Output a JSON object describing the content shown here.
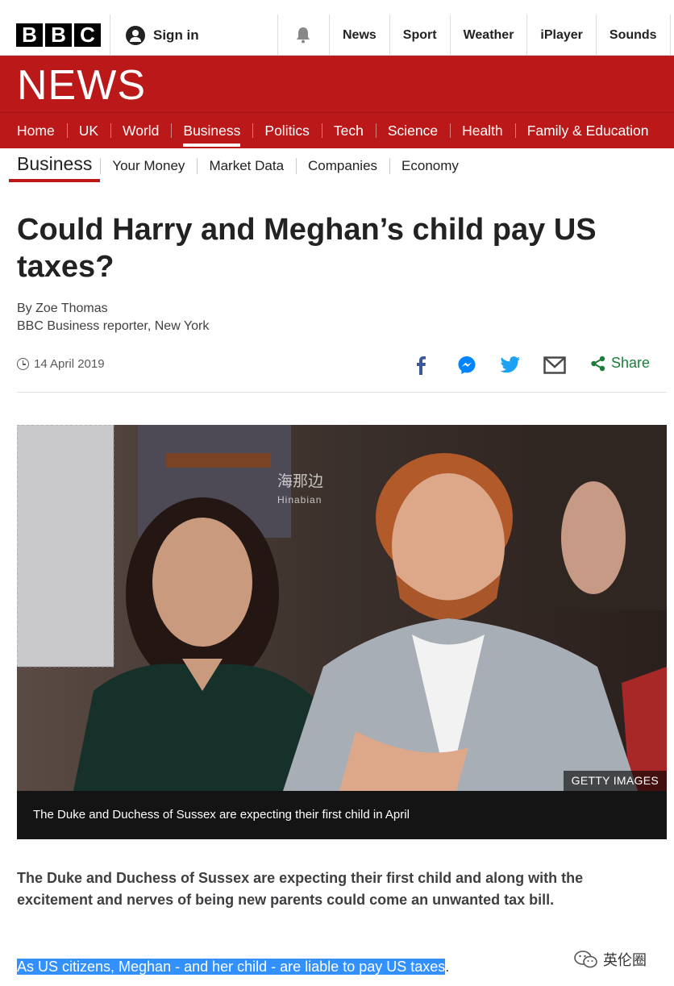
{
  "header": {
    "logo_letters": [
      "B",
      "B",
      "C"
    ],
    "sign_in": "Sign in",
    "nav": [
      "News",
      "Sport",
      "Weather",
      "iPlayer",
      "Sounds"
    ]
  },
  "banner": {
    "title": "NEWS"
  },
  "main_nav": {
    "items": [
      "Home",
      "UK",
      "World",
      "Business",
      "Politics",
      "Tech",
      "Science",
      "Health",
      "Family & Education"
    ],
    "active": "Business"
  },
  "sub_nav": {
    "section": "Business",
    "items": [
      "Your Money",
      "Market Data",
      "Companies",
      "Economy"
    ]
  },
  "article": {
    "headline": "Could Harry and Meghan’s child pay US taxes?",
    "author": "By Zoe Thomas",
    "author_role": "BBC Business reporter, New York",
    "date": "14 April 2019",
    "share_label": "Share",
    "image_credit": "GETTY IMAGES",
    "image_watermark": "海那边",
    "image_watermark_sub": "Hinabian",
    "caption": "The Duke and Duchess of Sussex are expecting their first child in April",
    "lede": "The Duke and Duchess of Sussex are expecting their first child and along with the excitement and nerves of being new parents could come an unwanted tax bill.",
    "paragraph_highlighted": "As US citizens, Meghan - and her child - are liable to pay US taxes",
    "paragraph_end": "."
  },
  "overlay": {
    "wechat_account": "英伦圈"
  },
  "colors": {
    "bbc_red": "#bb1919",
    "share_green": "#1a7d3a",
    "facebook": "#3b5998",
    "messenger": "#0084ff",
    "twitter": "#1da1f2",
    "highlight": "#3390ff"
  }
}
